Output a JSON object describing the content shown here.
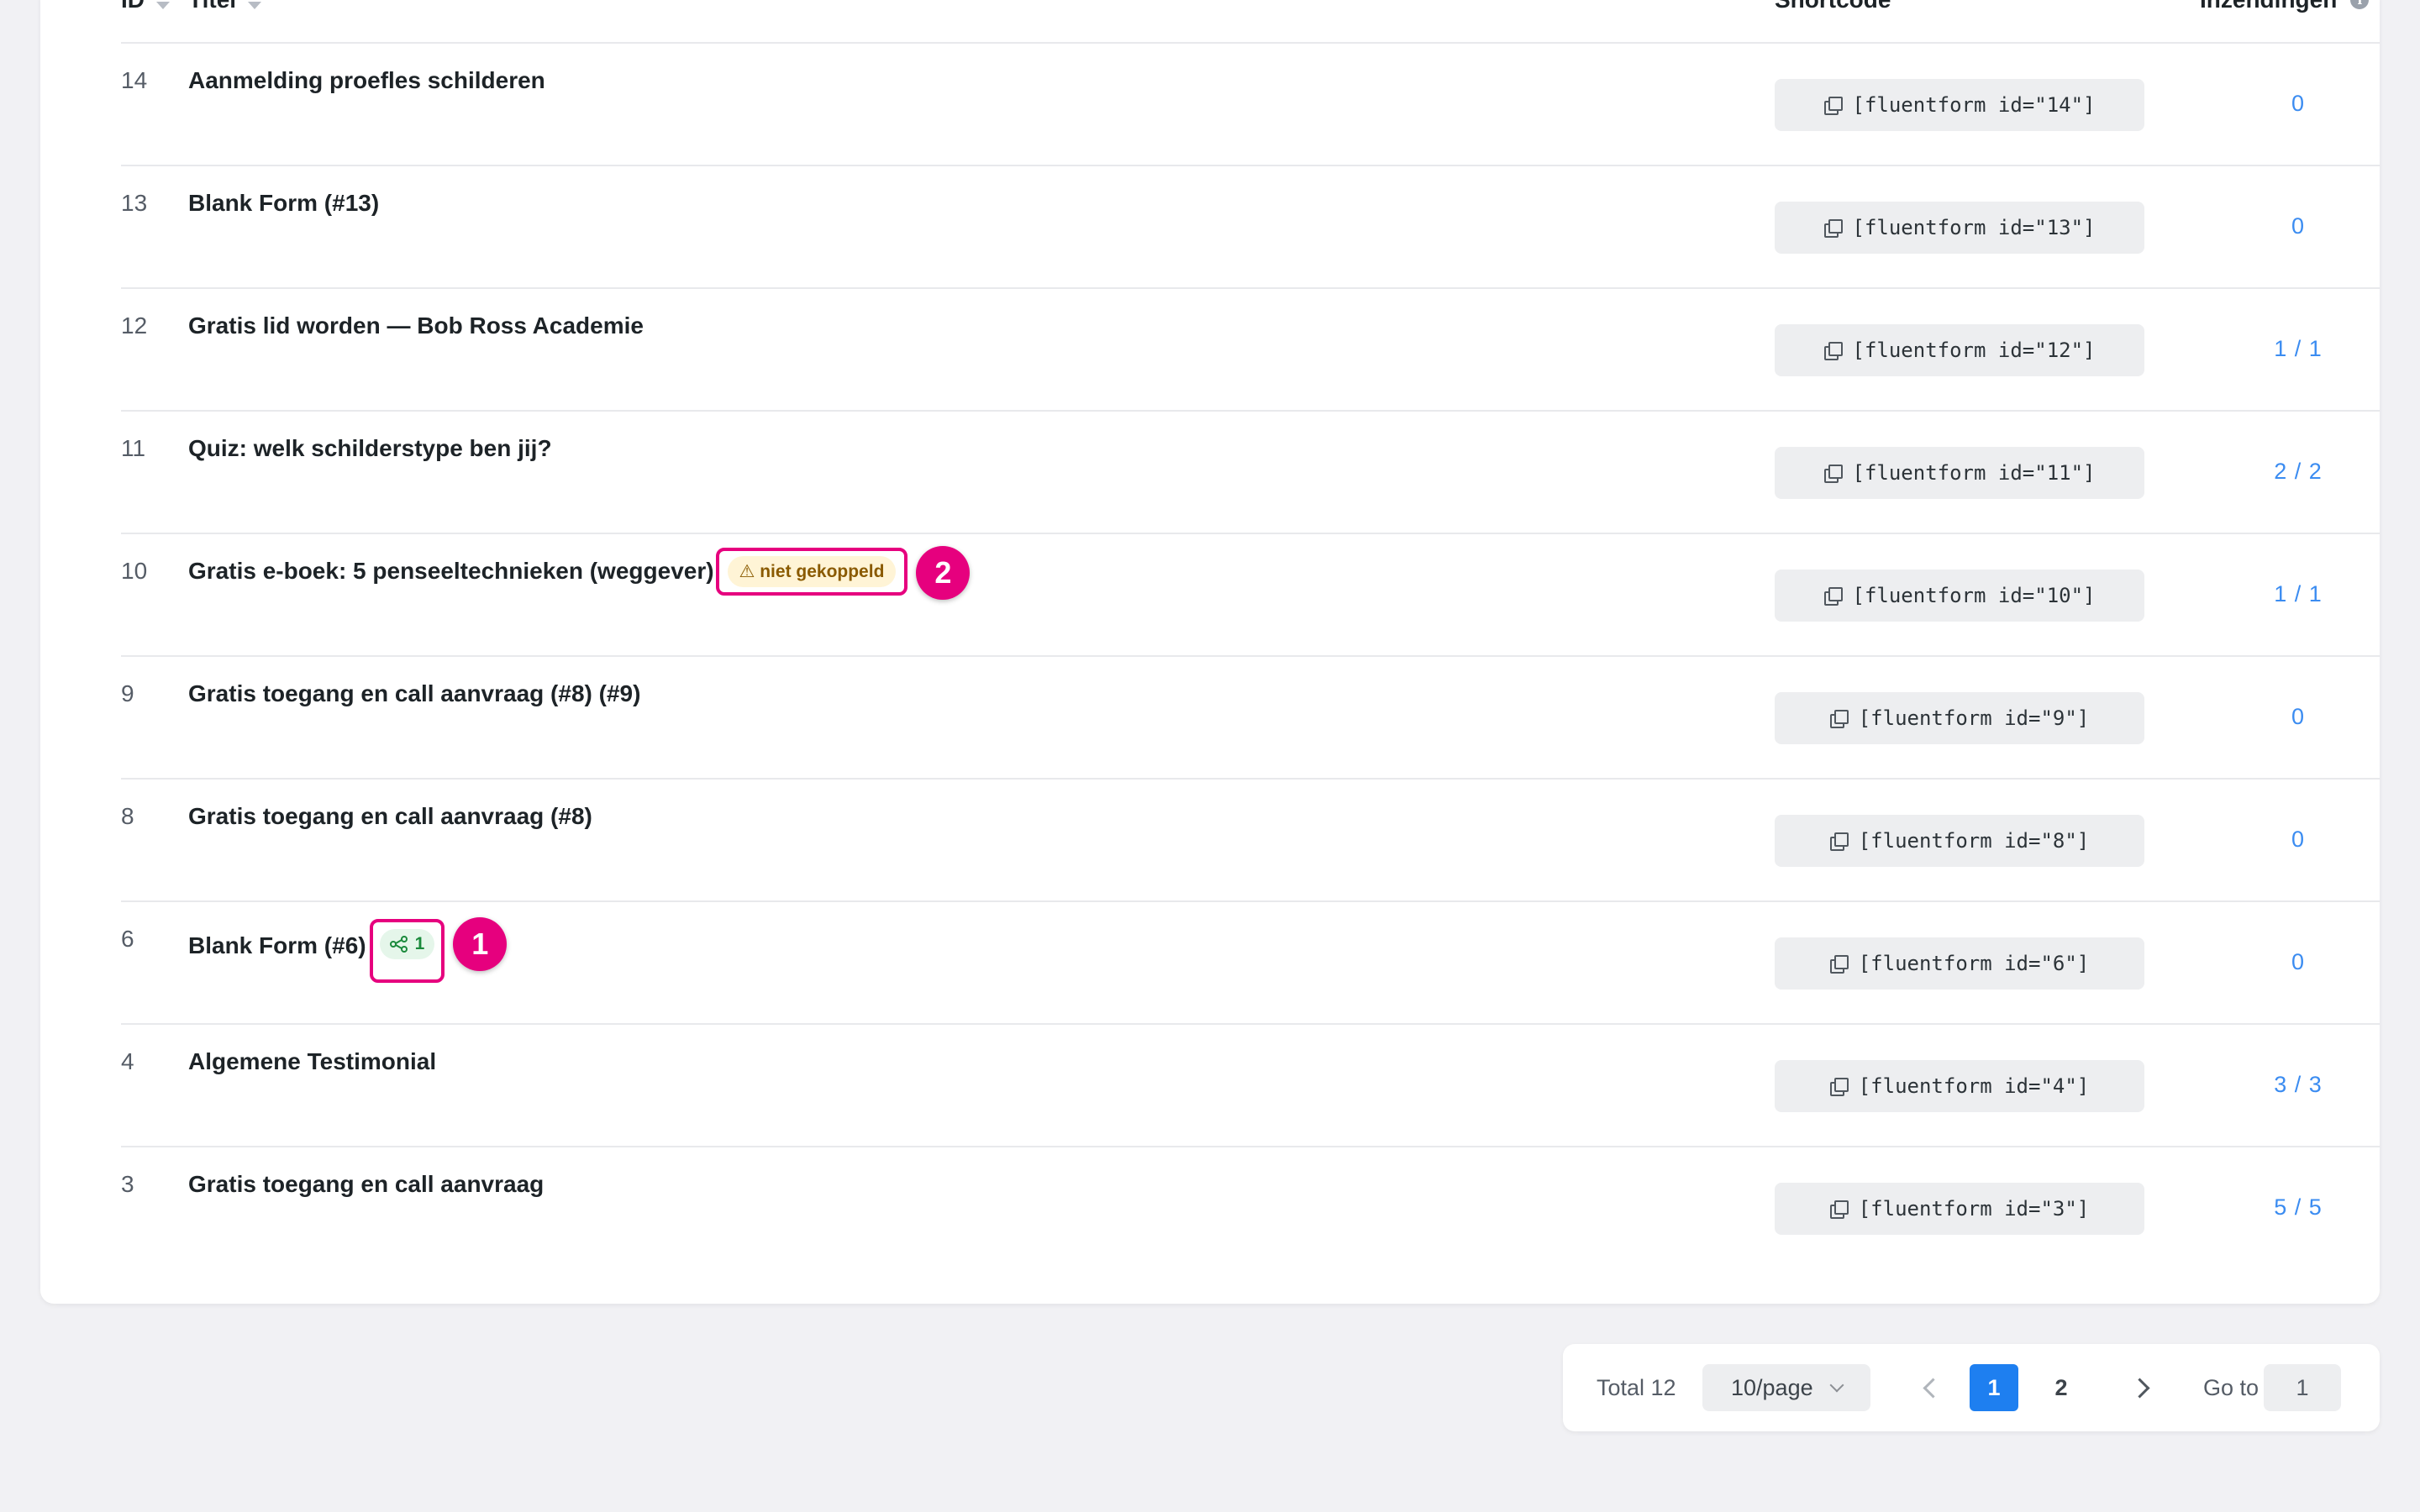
{
  "table": {
    "headers": {
      "id": "ID",
      "title": "Titel",
      "shortcode": "Shortcode",
      "submissions": "Inzendingen"
    },
    "rows": [
      {
        "id": "14",
        "title": "Aanmelding proefles schilderen",
        "shortcode": "[fluentform id=\"14\"]",
        "submissions": "0"
      },
      {
        "id": "13",
        "title": "Blank Form (#13)",
        "shortcode": "[fluentform id=\"13\"]",
        "submissions": "0"
      },
      {
        "id": "12",
        "title": "Gratis lid worden — Bob Ross Academie",
        "shortcode": "[fluentform id=\"12\"]",
        "submissions": "1 / 1"
      },
      {
        "id": "11",
        "title": "Quiz: welk schilderstype ben jij?",
        "shortcode": "[fluentform id=\"11\"]",
        "submissions": "2 / 2"
      },
      {
        "id": "10",
        "title": "Gratis e-boek: 5 penseeltechnieken (weggever)",
        "shortcode": "[fluentform id=\"10\"]",
        "submissions": "1 / 1",
        "badge": "⚠ niet gekoppeld"
      },
      {
        "id": "9",
        "title": "Gratis toegang en call aanvraag (#8) (#9)",
        "shortcode": "[fluentform id=\"9\"]",
        "submissions": "0"
      },
      {
        "id": "8",
        "title": "Gratis toegang en call aanvraag (#8)",
        "shortcode": "[fluentform id=\"8\"]",
        "submissions": "0"
      },
      {
        "id": "6",
        "title": "Blank Form (#6)",
        "shortcode": "[fluentform id=\"6\"]",
        "submissions": "0",
        "integration_count": "1"
      },
      {
        "id": "4",
        "title": "Algemene Testimonial",
        "shortcode": "[fluentform id=\"4\"]",
        "submissions": "3 / 3"
      },
      {
        "id": "3",
        "title": "Gratis toegang en call aanvraag",
        "shortcode": "[fluentform id=\"3\"]",
        "submissions": "5 / 5"
      }
    ]
  },
  "annotations": {
    "marker_1": "1",
    "marker_2": "2"
  },
  "pagination": {
    "total": "Total 12",
    "page_size": "10/page",
    "pages": [
      "1",
      "2"
    ],
    "current_page": "1",
    "goto_label": "Go to",
    "goto_value": "1"
  },
  "colors": {
    "accent": "#1e7ff0",
    "link": "#3b8cf1",
    "highlight": "#e6007e",
    "warning_bg": "#fff4d6",
    "success_bg": "#e5f6ea"
  }
}
